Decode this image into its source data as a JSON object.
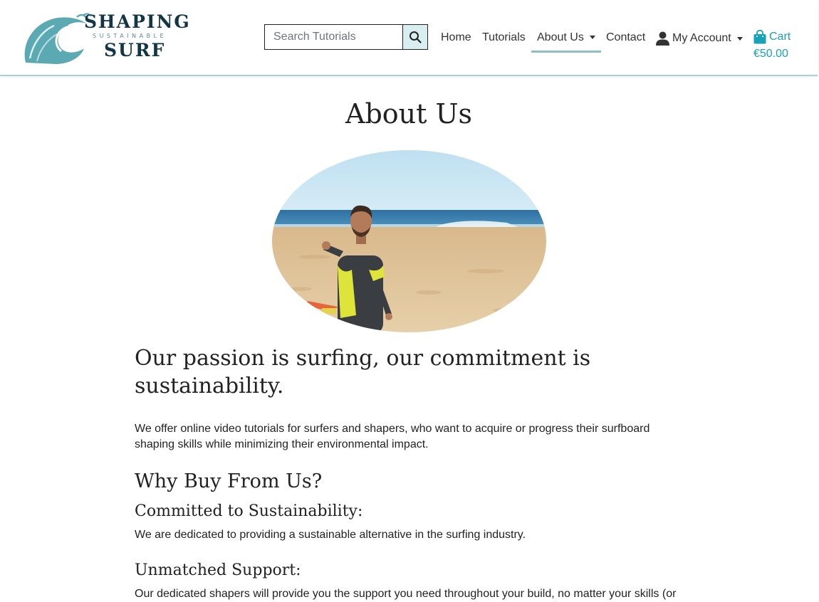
{
  "brand": {
    "line1": "SHAPING",
    "line2": "SUSTAINABLE",
    "line3": "SURF",
    "primary_color": "#123646",
    "wave_color": "#5aa9b3"
  },
  "search": {
    "placeholder": "Search Tutorials",
    "value": "",
    "icon": "search-icon"
  },
  "nav": {
    "home": "Home",
    "tutorials": "Tutorials",
    "about": "About Us",
    "contact": "Contact",
    "account": "My Account",
    "active": "About Us",
    "accent_color": "#17a2b8"
  },
  "cart": {
    "label": "Cart",
    "total": "€50.00"
  },
  "main": {
    "title": "About Us",
    "headline": "Our passion is surfing, our commitment is sustainability.",
    "intro": "We offer online video tutorials for surfers and shapers, who want to acquire or progress their surfboard shaping skills while minimizing their environmental impact.",
    "why_title": "Why Buy From Us?",
    "sections": [
      {
        "title": "Committed to Sustainability:",
        "text": "We are dedicated to providing a sustainable alternative in the surfing industry."
      },
      {
        "title": "Unmatched Support:",
        "text": "Our dedicated shapers will provide you the support you need throughout your build, no matter your skills (or"
      }
    ]
  }
}
